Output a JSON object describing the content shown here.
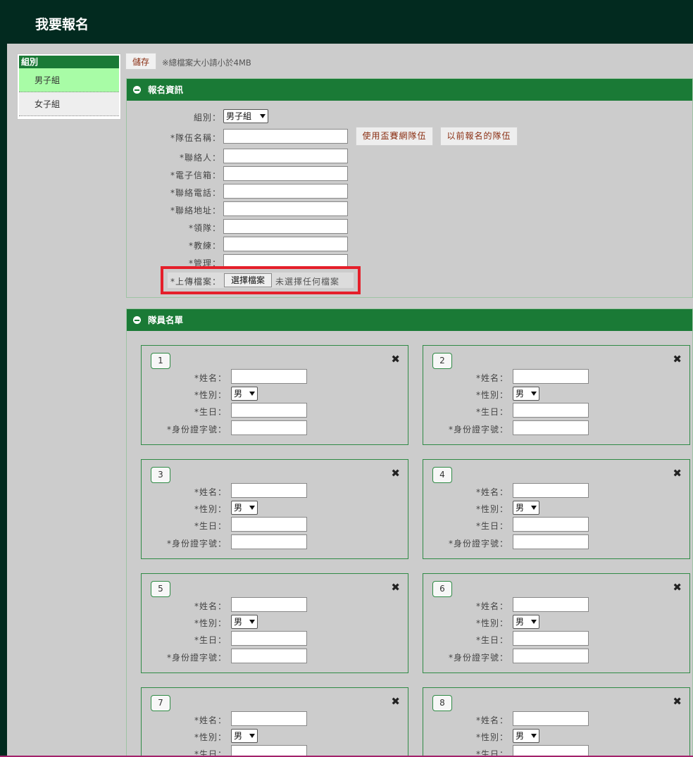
{
  "page_title": "我要報名",
  "sidebar": {
    "header": "組別",
    "items": [
      {
        "label": "男子組",
        "active": true
      },
      {
        "label": "女子組",
        "active": false
      }
    ]
  },
  "toolbar": {
    "save_label": "儲存",
    "size_note": "※總檔案大小請小於4MB"
  },
  "registration": {
    "header": "報名資訊",
    "group_label": "組別：",
    "group_value": "男子組",
    "team_name_label": "*隊伍名稱：",
    "use_previous_network_label": "使用盃賽網隊伍",
    "previous_team_label": "以前報名的隊伍",
    "contact_label": "*聯絡人：",
    "email_label": "*電子信箱：",
    "phone_label": "*聯絡電話：",
    "address_label": "*聯絡地址：",
    "leader_label": "*領隊：",
    "coach_label": "*教練：",
    "manager_label": "*管理：",
    "upload_label": "*上傳檔案：",
    "upload_button": "選擇檔案",
    "upload_status": "未選擇任何檔案"
  },
  "roster": {
    "header": "隊員名單",
    "labels": {
      "name": "*姓名：",
      "gender": "*性別：",
      "birth": "*生日：",
      "id": "*身份證字號："
    },
    "members": [
      {
        "number": "1",
        "gender": "男"
      },
      {
        "number": "2",
        "gender": "男"
      },
      {
        "number": "3",
        "gender": "男"
      },
      {
        "number": "4",
        "gender": "男"
      },
      {
        "number": "5",
        "gender": "男"
      },
      {
        "number": "6",
        "gender": "男"
      },
      {
        "number": "7",
        "gender": "男"
      },
      {
        "number": "8",
        "gender": "男"
      }
    ],
    "remove_icon": "close-icon"
  },
  "colors": {
    "header_bg": "#022a1f",
    "panel_header": "#1a7a36",
    "active_item": "#a8fca6",
    "highlight": "#e51f2a"
  }
}
